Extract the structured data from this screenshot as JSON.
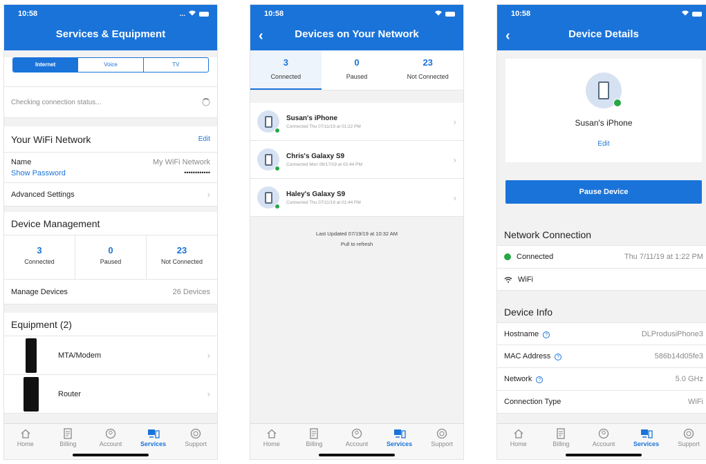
{
  "status_time": "10:58",
  "status_signal": "...",
  "tabs": [
    {
      "label": "Home",
      "icon": "home-icon"
    },
    {
      "label": "Billing",
      "icon": "billing-icon"
    },
    {
      "label": "Account",
      "icon": "account-icon"
    },
    {
      "label": "Services",
      "icon": "services-icon"
    },
    {
      "label": "Support",
      "icon": "support-icon"
    }
  ],
  "colors": {
    "brand": "#1a73d9",
    "connected": "#28a745"
  },
  "screen1": {
    "title": "Services & Equipment",
    "segments": [
      "Internet",
      "Voice",
      "TV"
    ],
    "selected_segment": "Internet",
    "checking_text": "Checking connection status...",
    "wifi": {
      "heading": "Your WiFi Network",
      "edit": "Edit",
      "name_label": "Name",
      "name_value": "My WiFi Network",
      "show_password": "Show Password",
      "password_mask": "••••••••••••",
      "advanced": "Advanced Settings"
    },
    "device_mgmt": {
      "heading": "Device Management",
      "stats": [
        {
          "value": "3",
          "label": "Connected"
        },
        {
          "value": "0",
          "label": "Paused"
        },
        {
          "value": "23",
          "label": "Not Connected"
        }
      ],
      "manage_label": "Manage Devices",
      "manage_value": "26 Devices"
    },
    "equipment": {
      "heading": "Equipment (2)",
      "items": [
        {
          "name": "MTA/Modem"
        },
        {
          "name": "Router"
        }
      ]
    }
  },
  "screen2": {
    "title": "Devices on Your Network",
    "counts": [
      {
        "value": "3",
        "label": "Connected"
      },
      {
        "value": "0",
        "label": "Paused"
      },
      {
        "value": "23",
        "label": "Not Connected"
      }
    ],
    "devices": [
      {
        "name": "Susan's iPhone",
        "sub": "Connected Thu 07/11/19 at 01:22 PM"
      },
      {
        "name": "Chris's Galaxy S9",
        "sub": "Connected Mon 06/17/19 at 02:44 PM"
      },
      {
        "name": "Haley's Galaxy S9",
        "sub": "Connected Thu 07/11/19 at 01:44 PM"
      }
    ],
    "last_updated": "Last Updated 07/19/19 at 10:32 AM",
    "pull_refresh": "Pull to refresh"
  },
  "screen3": {
    "title": "Device Details",
    "device_name": "Susan's iPhone",
    "edit": "Edit",
    "pause_button": "Pause Device",
    "network_heading": "Network Connection",
    "connected_label": "Connected",
    "connected_time": "Thu 7/11/19 at 1:22 PM",
    "wifi_label": "WiFi",
    "info_heading": "Device Info",
    "info_rows": [
      {
        "label": "Hostname",
        "value": "DLProdusiPhone3",
        "help": true
      },
      {
        "label": "MAC Address",
        "value": "586b14d05fe3",
        "help": true
      },
      {
        "label": "Network",
        "value": "5.0 GHz",
        "help": true
      },
      {
        "label": "Connection Type",
        "value": "WiFi",
        "help": false
      }
    ]
  }
}
